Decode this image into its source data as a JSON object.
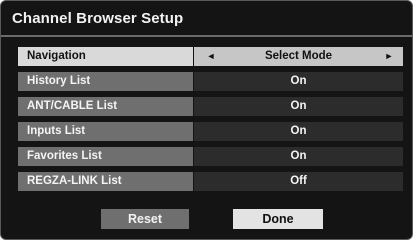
{
  "dialog": {
    "title": "Channel Browser Setup"
  },
  "rows": [
    {
      "label": "Navigation",
      "value": "Select Mode",
      "selected": true,
      "left_arrow": "◄",
      "right_arrow": "►"
    },
    {
      "label": "History List",
      "value": "On"
    },
    {
      "label": "ANT/CABLE List",
      "value": "On"
    },
    {
      "label": "Inputs List",
      "value": "On"
    },
    {
      "label": "Favorites List",
      "value": "On"
    },
    {
      "label": "REGZA-LINK List",
      "value": "Off"
    }
  ],
  "buttons": {
    "reset_label": "Reset",
    "done_label": "Done"
  }
}
